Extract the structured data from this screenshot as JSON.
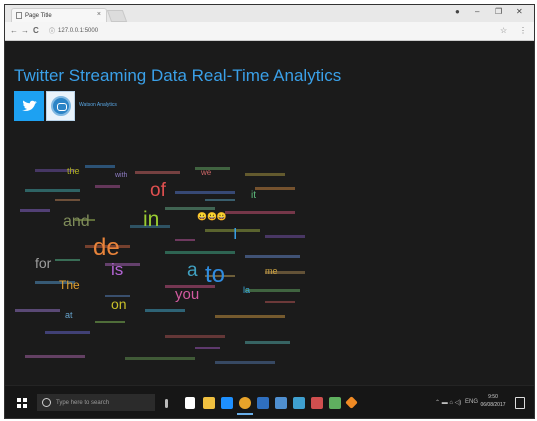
{
  "browser": {
    "tab_title": "Page Title",
    "tab_close": "×",
    "address": "127.0.0.1:5000",
    "back": "←",
    "forward": "→",
    "reload": "C",
    "info": "ⓘ",
    "star": "☆",
    "menu": "⋮",
    "minimize": "–",
    "maximize": "❐",
    "close": "✕",
    "profile": "●"
  },
  "page": {
    "title": "Twitter Streaming Data Real-Time Analytics",
    "watson_label": "Watson Analytics",
    "twitter_glyph": "🐦"
  },
  "word_cloud": {
    "words": [
      {
        "text": "de",
        "color": "#e8833a"
      },
      {
        "text": "to",
        "color": "#2f8ce0"
      },
      {
        "text": "in",
        "color": "#9acd32"
      },
      {
        "text": "of",
        "color": "#e05050"
      },
      {
        "text": "and",
        "color": "#7f8c5a"
      },
      {
        "text": "is",
        "color": "#b565d6"
      },
      {
        "text": "you",
        "color": "#d35aa0"
      },
      {
        "text": "for",
        "color": "#9e9e9e"
      },
      {
        "text": "The",
        "color": "#e0a030"
      },
      {
        "text": "on",
        "color": "#c9c02a"
      },
      {
        "text": "a",
        "color": "#40a0c0"
      },
      {
        "text": "la",
        "color": "#3aa8d8"
      },
      {
        "text": "the",
        "color": "#b0b020"
      },
      {
        "text": "with",
        "color": "#8e7cc3"
      },
      {
        "text": "😀😀😀",
        "color": "#f2c94c"
      },
      {
        "text": "it",
        "color": "#5fbf7f"
      },
      {
        "text": "I",
        "color": "#3aa0e8"
      },
      {
        "text": "me",
        "color": "#c8a040"
      },
      {
        "text": "we",
        "color": "#cc6666"
      },
      {
        "text": "at",
        "color": "#66a3cc"
      }
    ]
  },
  "taskbar": {
    "search_placeholder": "Type here to search",
    "tray_text": "ENG",
    "time": "9:50",
    "date": "06/08/2017"
  },
  "colors": {
    "title_blue": "#3aa0e8",
    "twitter_blue": "#1da1f2",
    "page_bg": "#1b1b1b",
    "taskbar_bg": "#161616"
  }
}
